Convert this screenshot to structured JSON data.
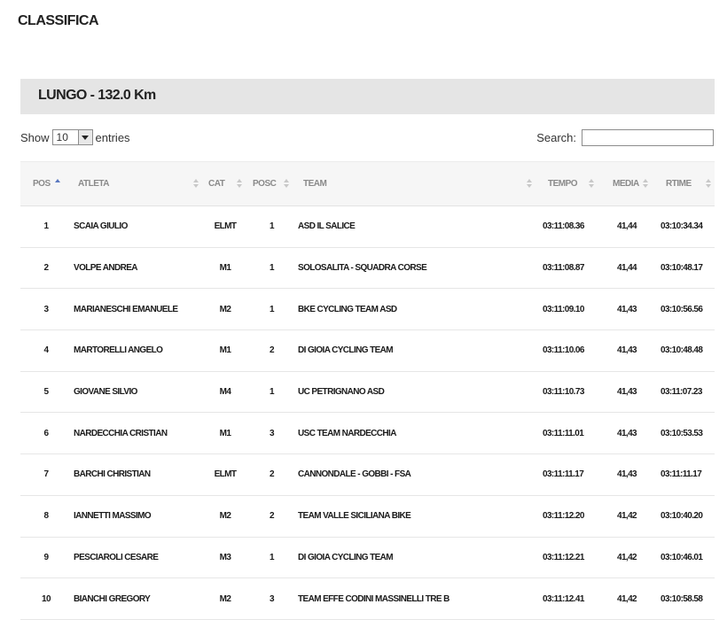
{
  "page": {
    "title": "CLASSIFICA"
  },
  "race": {
    "title": "LUNGO - 132.0 Km"
  },
  "controls": {
    "show_label": "Show",
    "page_size": "10",
    "entries_label": "entries",
    "search_label": "Search:",
    "search_value": ""
  },
  "table": {
    "columns": [
      "POS",
      "ATLETA",
      "CAT",
      "POSC",
      "TEAM",
      "TEMPO",
      "MEDIA",
      "RTIME"
    ],
    "sort": {
      "column": "POS",
      "direction": "ascending"
    },
    "rows": [
      {
        "pos": "1",
        "atleta": "SCAIA GIULIO",
        "cat": "ELMT",
        "posc": "1",
        "team": "ASD IL SALICE",
        "tempo": "03:11:08.36",
        "media": "41,44",
        "rtime": "03:10:34.34"
      },
      {
        "pos": "2",
        "atleta": "VOLPE ANDREA",
        "cat": "M1",
        "posc": "1",
        "team": "SOLOSALITA - SQUADRA CORSE",
        "tempo": "03:11:08.87",
        "media": "41,44",
        "rtime": "03:10:48.17"
      },
      {
        "pos": "3",
        "atleta": "MARIANESCHI EMANUELE",
        "cat": "M2",
        "posc": "1",
        "team": "BKE CYCLING TEAM ASD",
        "tempo": "03:11:09.10",
        "media": "41,43",
        "rtime": "03:10:56.56"
      },
      {
        "pos": "4",
        "atleta": "MARTORELLI ANGELO",
        "cat": "M1",
        "posc": "2",
        "team": "DI GIOIA CYCLING TEAM",
        "tempo": "03:11:10.06",
        "media": "41,43",
        "rtime": "03:10:48.48"
      },
      {
        "pos": "5",
        "atleta": "GIOVANE SILVIO",
        "cat": "M4",
        "posc": "1",
        "team": "UC PETRIGNANO ASD",
        "tempo": "03:11:10.73",
        "media": "41,43",
        "rtime": "03:11:07.23"
      },
      {
        "pos": "6",
        "atleta": "NARDECCHIA CRISTIAN",
        "cat": "M1",
        "posc": "3",
        "team": "USC TEAM NARDECCHIA",
        "tempo": "03:11:11.01",
        "media": "41,43",
        "rtime": "03:10:53.53"
      },
      {
        "pos": "7",
        "atleta": "BARCHI CHRISTIAN",
        "cat": "ELMT",
        "posc": "2",
        "team": "CANNONDALE - GOBBI - FSA",
        "tempo": "03:11:11.17",
        "media": "41,43",
        "rtime": "03:11:11.17"
      },
      {
        "pos": "8",
        "atleta": "IANNETTI MASSIMO",
        "cat": "M2",
        "posc": "2",
        "team": "TEAM VALLE SICILIANA BIKE",
        "tempo": "03:11:12.20",
        "media": "41,42",
        "rtime": "03:10:40.20"
      },
      {
        "pos": "9",
        "atleta": "PESCIAROLI CESARE",
        "cat": "M3",
        "posc": "1",
        "team": "DI GIOIA CYCLING TEAM",
        "tempo": "03:11:12.21",
        "media": "41,42",
        "rtime": "03:10:46.01"
      },
      {
        "pos": "10",
        "atleta": "BIANCHI GREGORY",
        "cat": "M2",
        "posc": "3",
        "team": "TEAM EFFE CODINI MASSINELLI TRE B",
        "tempo": "03:11:12.41",
        "media": "41,42",
        "rtime": "03:10:58.58"
      }
    ]
  },
  "colors": {
    "header_band": "#e5e5e5",
    "table_head_bg": "#f6f6f6",
    "sort_active": "#5a78c0",
    "row_border": "#e6e6e6"
  }
}
